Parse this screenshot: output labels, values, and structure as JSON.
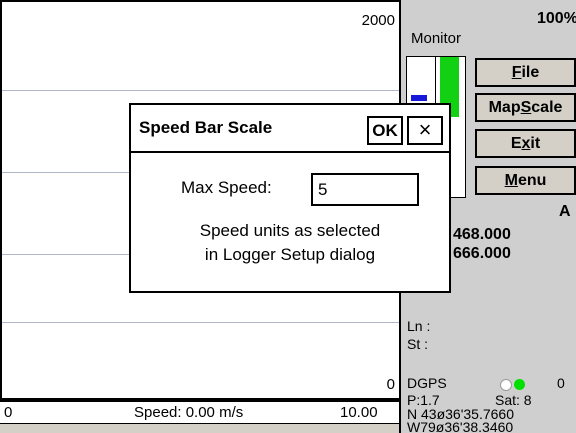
{
  "chart": {
    "y_max_label": "2000",
    "y_min_label": "0"
  },
  "speed_bar": {
    "left_label": "0",
    "center_label": "Speed: 0.00 m/s",
    "right_label": "10.00"
  },
  "panel": {
    "percent": "100%",
    "monitor_label": "Monitor",
    "buttons": [
      {
        "pre": "",
        "key": "F",
        "post": "ile"
      },
      {
        "pre": "Map",
        "key": "S",
        "post": "cale"
      },
      {
        "pre": "E",
        "key": "x",
        "post": "it"
      },
      {
        "pre": "",
        "key": "M",
        "post": "enu"
      }
    ],
    "coord_flag": "A",
    "coord_1": "468.000",
    "coord_2": "666.000",
    "ln_label": "Ln :",
    "st_label": "St :",
    "dgps_label": "DGPS",
    "dgps_count": "0",
    "p_value": "P:1.7",
    "sat_value": "Sat: 8",
    "lat": "N 43ø36'35.7660",
    "lon": "W79ø36'38.3460"
  },
  "dialog": {
    "title": "Speed Bar Scale",
    "ok_label": "OK",
    "close_label": "×",
    "field_label": "Max Speed:",
    "field_value": "5",
    "note_line1": "Speed units as selected",
    "note_line2": "in Logger Setup dialog"
  },
  "colors": {
    "panel_bg": "#cfcfcf",
    "gauge_green": "#12d012",
    "gauge_blue": "#1818d8",
    "grid_line": "#aeb6c8"
  }
}
